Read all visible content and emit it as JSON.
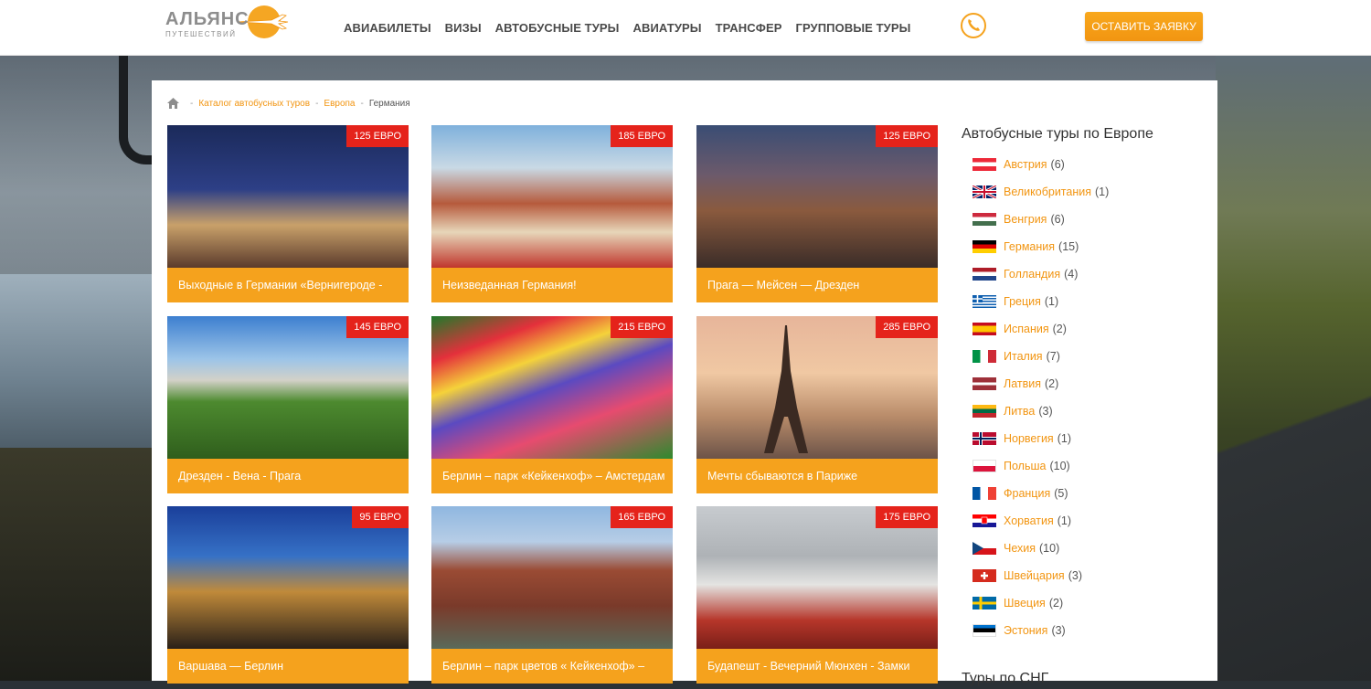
{
  "header": {
    "logo_brand": "АЛЬЯНС",
    "logo_tagline": "ПУТЕШЕСТВИЙ",
    "nav": [
      "АВИАБИЛЕТЫ",
      "ВИЗЫ",
      "АВТОБУСНЫЕ ТУРЫ",
      "АВИАТУРЫ",
      "ТРАНСФЕР",
      "ГРУППОВЫЕ ТУРЫ"
    ],
    "cta_label": "ОСТАВИТЬ ЗАЯВКУ",
    "phone_icon": "phone-icon",
    "accent_color": "#f5a21d"
  },
  "breadcrumb": {
    "home_icon": "home-icon",
    "items": [
      "Каталог автобусных туров",
      "Европа"
    ],
    "current": "Германия"
  },
  "tours": [
    {
      "price": "125 ЕВРО",
      "title": "Выходные в Германии «Вернигероде -",
      "image": "berlin-night"
    },
    {
      "price": "185 ЕВРО",
      "title": "Неизведанная Германия!",
      "image": "german-town-square"
    },
    {
      "price": "125 ЕВРО",
      "title": "Прага — Мейсен — Дрезден",
      "image": "prague-bridge-tower"
    },
    {
      "price": "145 ЕВРО",
      "title": "Дрезден - Вена - Прага",
      "image": "vienna-park"
    },
    {
      "price": "215 ЕВРО",
      "title": "Берлин – парк «Кейкенхоф» – Амстердам",
      "image": "tulip-fields"
    },
    {
      "price": "285 ЕВРО",
      "title": "Мечты сбываются в Париже",
      "image": "eiffel-tower"
    },
    {
      "price": "95 ЕВРО",
      "title": "Варшава — Берлин",
      "image": "dresden-night"
    },
    {
      "price": "165 ЕВРО",
      "title": "Берлин – парк цветов « Кейкенхоф» –",
      "image": "rijksmuseum"
    },
    {
      "price": "175 ЕВРО",
      "title": "Будапешт - Вечерний Мюнхен - Замки",
      "image": "neuschwanstein"
    }
  ],
  "sidebar": {
    "title": "Автобусные туры по Европе",
    "countries": [
      {
        "name": "Австрия",
        "count": "(6)",
        "flag": "austria"
      },
      {
        "name": "Великобритания",
        "count": "(1)",
        "flag": "uk"
      },
      {
        "name": "Венгрия",
        "count": "(6)",
        "flag": "hungary"
      },
      {
        "name": "Германия",
        "count": "(15)",
        "flag": "germany"
      },
      {
        "name": "Голландия",
        "count": "(4)",
        "flag": "netherlands"
      },
      {
        "name": "Греция",
        "count": "(1)",
        "flag": "greece"
      },
      {
        "name": "Испания",
        "count": "(2)",
        "flag": "spain"
      },
      {
        "name": "Италия",
        "count": "(7)",
        "flag": "italy"
      },
      {
        "name": "Латвия",
        "count": "(2)",
        "flag": "latvia"
      },
      {
        "name": "Литва",
        "count": "(3)",
        "flag": "lithuania"
      },
      {
        "name": "Норвегия",
        "count": "(1)",
        "flag": "norway"
      },
      {
        "name": "Польша",
        "count": "(10)",
        "flag": "poland"
      },
      {
        "name": "Франция",
        "count": "(5)",
        "flag": "france"
      },
      {
        "name": "Хорватия",
        "count": "(1)",
        "flag": "croatia"
      },
      {
        "name": "Чехия",
        "count": "(10)",
        "flag": "czech"
      },
      {
        "name": "Швейцария",
        "count": "(3)",
        "flag": "switzerland"
      },
      {
        "name": "Швеция",
        "count": "(2)",
        "flag": "sweden"
      },
      {
        "name": "Эстония",
        "count": "(3)",
        "flag": "estonia"
      }
    ],
    "second_title": "Туры по СНГ"
  }
}
